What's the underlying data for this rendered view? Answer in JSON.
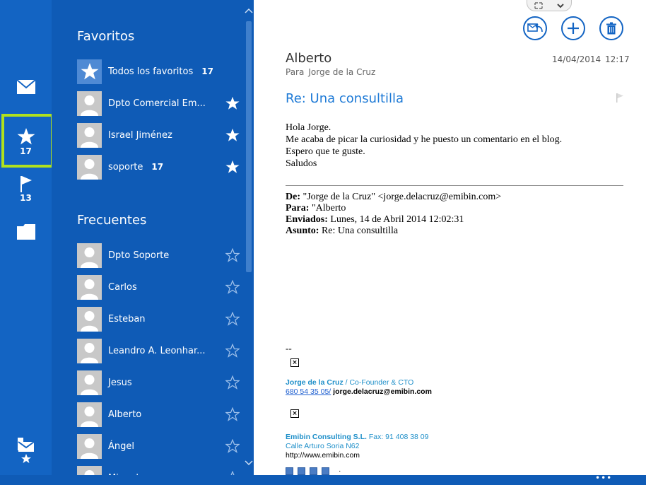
{
  "rail": {
    "mail_icon": "mail-icon",
    "favorites_count": "17",
    "flagged_count": "13",
    "folder_icon": "folder-icon",
    "compose_fav_icon": "mail-star-icon",
    "highlight_color": "#b0e11e"
  },
  "favorites": {
    "title": "Favoritos",
    "items": [
      {
        "name": "Todos los favoritos",
        "count": "17",
        "starred": true,
        "icon": "star-icon"
      },
      {
        "name": "Dpto Comercial Em...",
        "count": "",
        "starred": true
      },
      {
        "name": "Israel Jiménez",
        "count": "",
        "starred": true
      },
      {
        "name": "soporte",
        "count": "17",
        "starred": true
      }
    ]
  },
  "frequent": {
    "title": "Frecuentes",
    "items": [
      {
        "name": "Dpto Soporte"
      },
      {
        "name": "Carlos"
      },
      {
        "name": "Esteban"
      },
      {
        "name": "Leandro A. Leonhar..."
      },
      {
        "name": "Jesus"
      },
      {
        "name": "Alberto"
      },
      {
        "name": "Ángel"
      },
      {
        "name": "Miguel"
      }
    ]
  },
  "message": {
    "sender": "Alberto",
    "to_label": "Para",
    "to_name": "Jorge de la Cruz",
    "date": "14/04/2014",
    "time": "12:17",
    "subject": "Re: Una consultilla",
    "body": [
      "Hola Jorge.",
      "Me acaba de picar la curiosidad y he puesto un comentario en el blog.",
      "Espero que te guste.",
      "Saludos"
    ],
    "quoted": {
      "from_label": "De:",
      "from_value": "\"Jorge de la Cruz\" <jorge.delacruz@emibin.com>",
      "to_label": "Para:",
      "to_value": "\"Alberto",
      "sent_label": "Enviados:",
      "sent_value": "Lunes, 14 de Abril 2014 12:02:31",
      "subject_label": "Asunto:",
      "subject_value": "Re: Una consultilla"
    },
    "signature": {
      "dash": "--",
      "name": "Jorge de la Cruz",
      "role": " / Co-Founder & CTO",
      "phone": "680 54 35 05/",
      "email": " jorge.delacruz@emibin.com",
      "company": "Emibin Consulting S.L.",
      "fax": " Fax: 91 408 38 09",
      "address": "Calle Arturo Soria N62",
      "web": "http://www.emibin.com",
      "separator": "·"
    }
  },
  "actions": {
    "reply_icon": "reply-icon",
    "new_icon": "plus-icon",
    "delete_icon": "trash-icon",
    "accent": "#1364c3"
  },
  "more_label": "•••"
}
